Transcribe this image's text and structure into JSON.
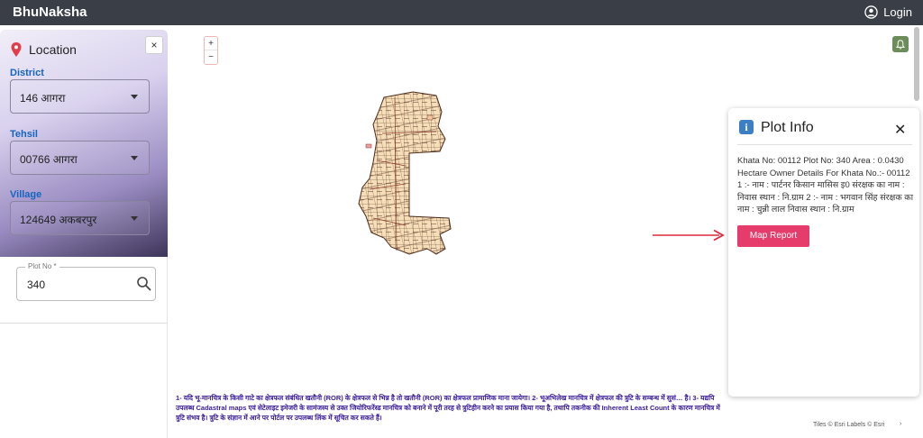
{
  "app": {
    "brand": "BhuNaksha",
    "login_label": "Login"
  },
  "location_panel": {
    "title": "Location",
    "close_label": "×",
    "district": {
      "label": "District",
      "value": "146 आगरा"
    },
    "tehsil": {
      "label": "Tehsil",
      "value": "00766 आगरा"
    },
    "village": {
      "label": "Village",
      "value": "124649 अकबरपुर"
    },
    "plot": {
      "label": "Plot No *",
      "value": "340"
    }
  },
  "map_controls": {
    "zoom_in": "+",
    "zoom_out": "−"
  },
  "plot_info": {
    "title": "Plot Info",
    "close_label": "✕",
    "details": "Khata No: 00112 Plot No: 340 Area : 0.0430 Hectare Owner Details For Khata No.:- 00112 1 :- नाम : पार्टनर किसान मासिस इ0 संरक्षक का नाम : निवास स्थान : नि.ग्राम 2 :- नाम : भगवान सिंह संरक्षक का नाम : चुन्नी लाल निवास स्थान : नि.ग्राम",
    "map_report_label": "Map Report"
  },
  "disclaimer": "1- यदि भू-मानचित्र के किसी गाटे का क्षेत्रफल संबंधित खतौनी (ROR) के क्षेत्रफल से भिन्न है तो खतौनी (ROR) का क्षेत्रफल प्रामाणिक माना जायेगा। 2- भूअभिलेख मानचित्र में क्षेत्रफल की त्रुटि के सम्बन्ध में सुसं… है। 3- यद्यपि उपलब्ध Cadastral maps एवं सेटेलाइट इमेजरी के सामंजस्य से उक्त जियोरिफरेंस्ड मानचित्र को बनाने में पूरी तरह से त्रुटिहीन करने का प्रयास किया गया है, तथापि तकनीक की Inherent Least Count के कारण मानचित्र में त्रुटि संभव है। त्रुटि के संज्ञान में आने पर पोर्टल पर उपलब्ध लिंक में सूचित कर सकते हैं।",
  "attribution": "Tiles © Esri Labels © Esri",
  "attribution_toggle": "›",
  "colors": {
    "topbar": "#3a3f47",
    "accent": "#e53c6b",
    "label_blue": "#1565c0",
    "disclaimer": "#3a1a9a",
    "arrow": "#e0283c"
  },
  "icons": [
    "user-circle-icon",
    "location-pin-icon",
    "search-icon",
    "bell-icon",
    "info-icon",
    "close-icon",
    "chevron-down-icon",
    "arrow-right-icon"
  ]
}
